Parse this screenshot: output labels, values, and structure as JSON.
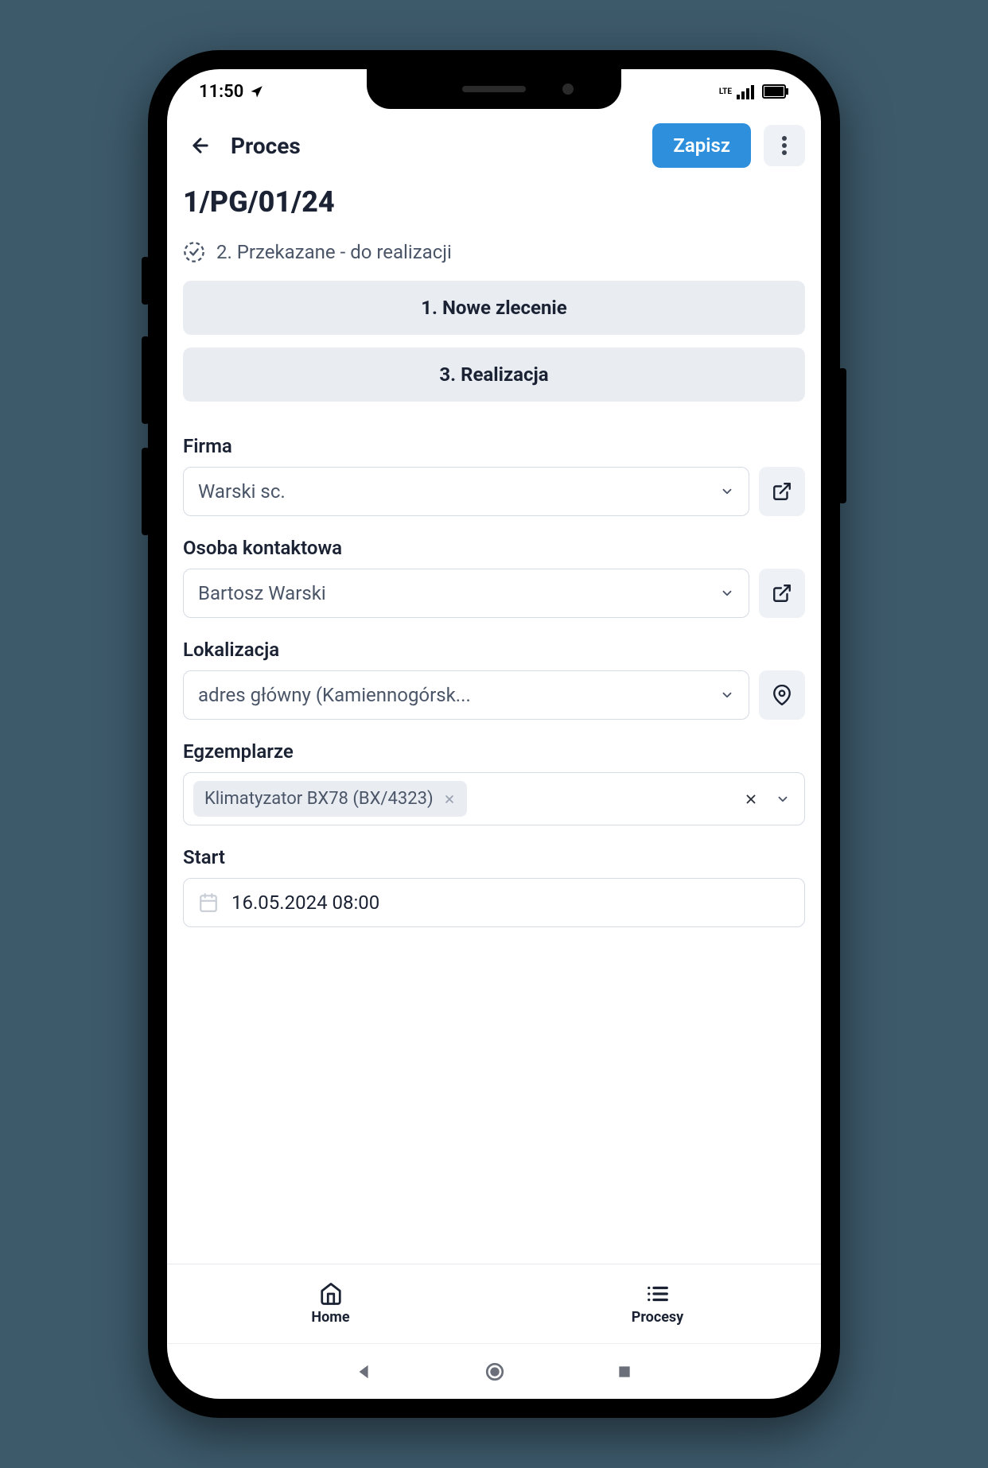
{
  "status_bar": {
    "time": "11:50",
    "network": "LTE"
  },
  "header": {
    "title": "Proces",
    "save_label": "Zapisz"
  },
  "page": {
    "id": "1/PG/01/24",
    "status_text": "2. Przekazane - do realizacji",
    "stage_prev": "1. Nowe zlecenie",
    "stage_next": "3. Realizacja"
  },
  "fields": {
    "firma": {
      "label": "Firma",
      "value": "Warski sc."
    },
    "osoba": {
      "label": "Osoba kontaktowa",
      "value": "Bartosz Warski"
    },
    "lokalizacja": {
      "label": "Lokalizacja",
      "value": "adres główny (Kamiennogórsk..."
    },
    "egzemplarze": {
      "label": "Egzemplarze",
      "chip": "Klimatyzator BX78 (BX/4323)"
    },
    "start": {
      "label": "Start",
      "value": "16.05.2024 08:00"
    }
  },
  "nav": {
    "home": "Home",
    "procesy": "Procesy"
  }
}
